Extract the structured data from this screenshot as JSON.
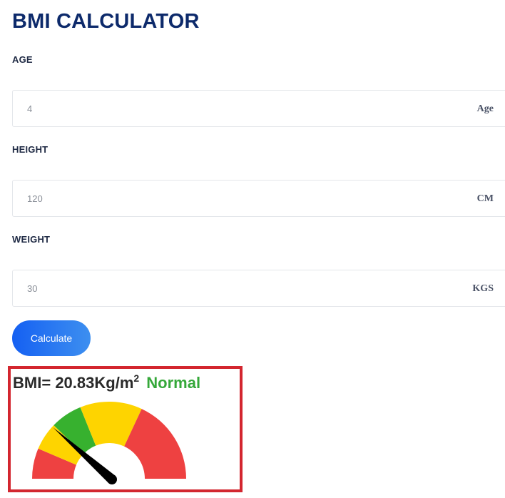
{
  "title": "BMI CALCULATOR",
  "fields": {
    "age": {
      "label": "AGE",
      "placeholder": "4",
      "unit": "Age"
    },
    "height": {
      "label": "HEIGHT",
      "placeholder": "120",
      "unit": "CM"
    },
    "weight": {
      "label": "WEIGHT",
      "placeholder": "30",
      "unit": "KGS"
    }
  },
  "button": {
    "label": "Calculate"
  },
  "result": {
    "prefix": "BMI=",
    "value": "20.83",
    "unit": "Kg/m",
    "unit_exponent": "2",
    "status": "Normal"
  },
  "colors": {
    "title": "#0d2a6b",
    "button_start": "#1560f2",
    "button_end": "#3d8ff0",
    "status_normal": "#35a83a",
    "highlight_border": "#d3262f",
    "gauge_red": "#ee4141",
    "gauge_yellow": "#fed400",
    "gauge_green": "#37b12f",
    "needle": "#000000"
  },
  "gauge": {
    "segments": [
      "red",
      "yellow",
      "green",
      "yellow",
      "red"
    ],
    "needle_level": 0.23
  }
}
